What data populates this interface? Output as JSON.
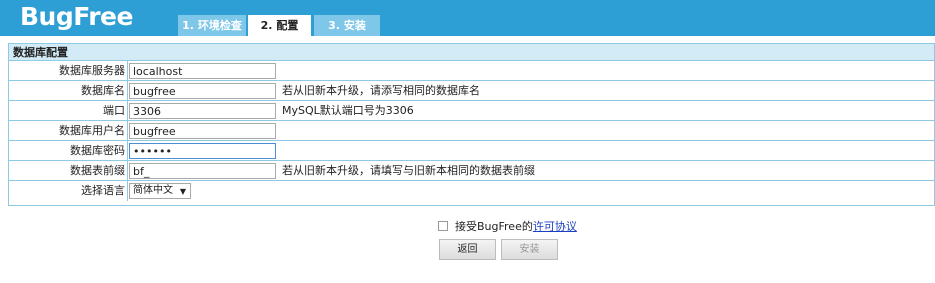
{
  "app": {
    "logo": "BugFree"
  },
  "tabs": [
    {
      "label": "1. 环境检查",
      "active": false
    },
    {
      "label": "2. 配置",
      "active": true
    },
    {
      "label": "3. 安装",
      "active": false
    }
  ],
  "panel": {
    "title": "数据库配置",
    "rows": [
      {
        "label": "数据库服务器",
        "value": "localhost",
        "hint": ""
      },
      {
        "label": "数据库名",
        "value": "bugfree",
        "hint": "若从旧新本升级，请添写相同的数据库名"
      },
      {
        "label": "端口",
        "value": "3306",
        "hint": "MySQL默认端口号为3306"
      },
      {
        "label": "数据库用户名",
        "value": "bugfree",
        "hint": ""
      },
      {
        "label": "数据库密码",
        "value": "••••••",
        "hint": ""
      },
      {
        "label": "数据表前缀",
        "value": "bf_",
        "hint": "若从旧新本升级，请填写与旧新本相同的数据表前缀"
      },
      {
        "label": "选择语言",
        "value": "简体中文",
        "hint": ""
      }
    ]
  },
  "agreement": {
    "text": "接受BugFree的",
    "link": "许可协议",
    "checked": false
  },
  "buttons": {
    "back": "返回",
    "install": "安装"
  },
  "colors": {
    "header_bg": "#2d9fd4",
    "panel_header_bg": "#d2ebf7",
    "border": "#8ec9e6"
  }
}
